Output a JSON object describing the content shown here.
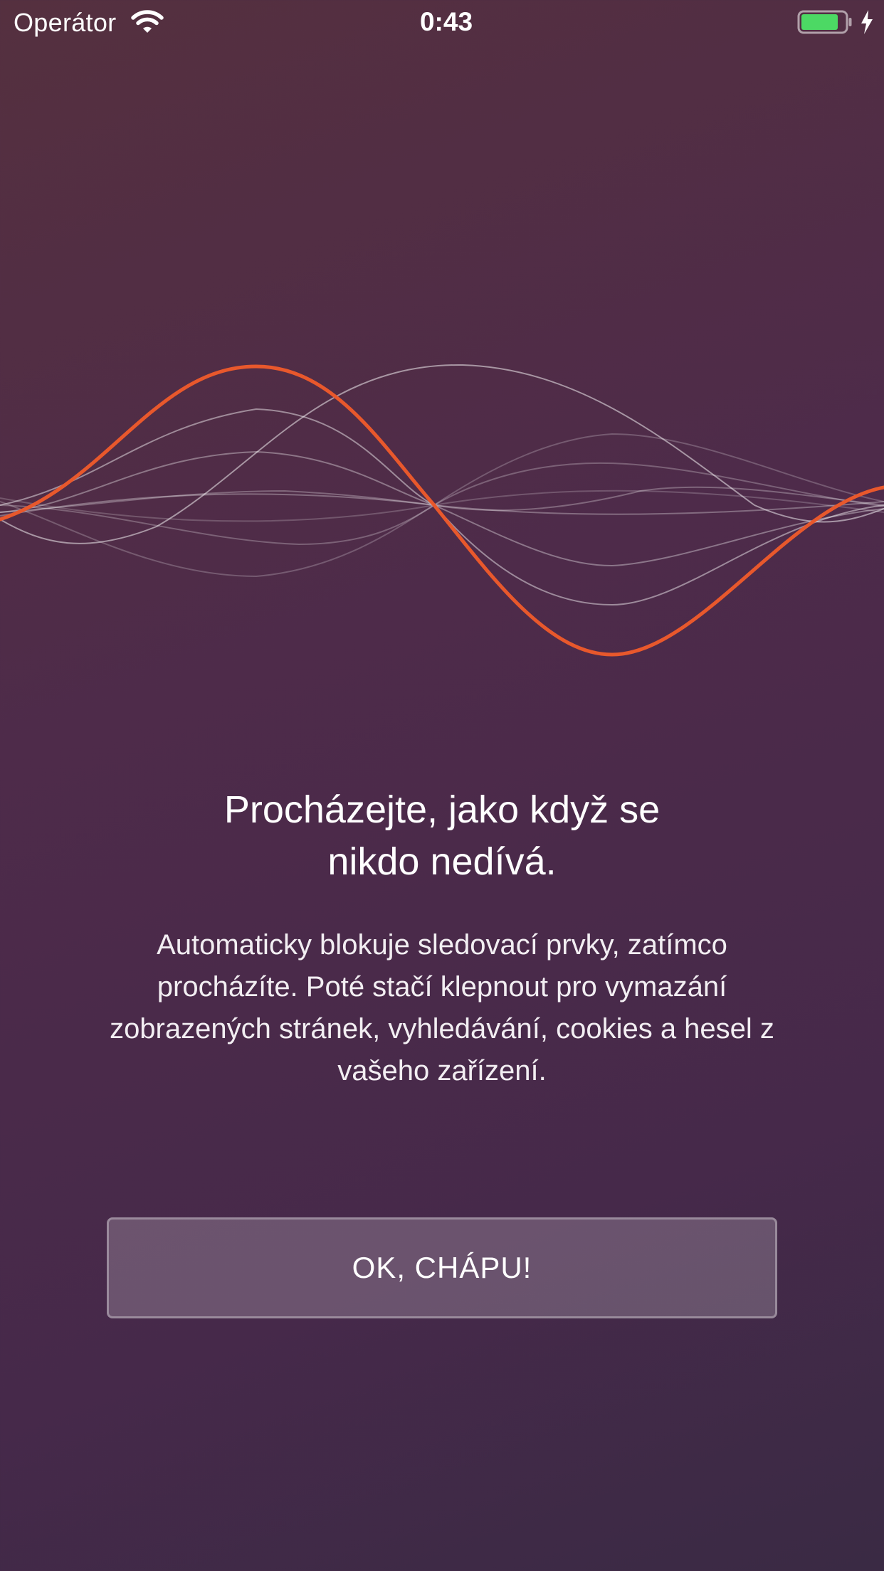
{
  "status_bar": {
    "carrier": "Operátor",
    "time": "0:43",
    "wifi_icon": "wifi-icon",
    "battery_icon": "battery-icon",
    "charging_icon": "bolt-icon",
    "battery_level": 0.85,
    "battery_color": "#4cd964"
  },
  "onboarding": {
    "illustration": "wave-illustration",
    "accent_color": "#e8582c",
    "title": "Procházejte, jako když se\nnikdo nedívá.",
    "description": "Automaticky blokuje sledovací prvky, zatímco procházíte. Poté stačí klepnout pro vymazání zobrazených stránek, vyhledávání, cookies a hesel z vašeho zařízení.",
    "confirm_button": "OK, CHÁPU!"
  }
}
